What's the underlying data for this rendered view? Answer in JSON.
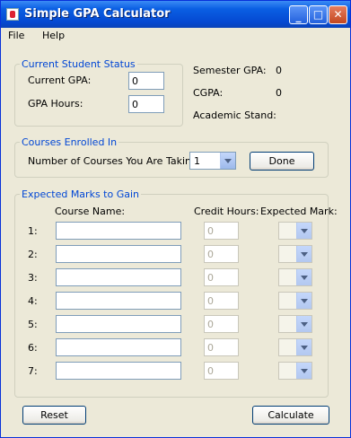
{
  "window": {
    "title": "Simple GPA Calculator"
  },
  "menu": {
    "items": [
      "File",
      "Help"
    ]
  },
  "status": {
    "title": "Current Student Status",
    "current_gpa_label": "Current GPA:",
    "current_gpa_value": "0",
    "gpa_hours_label": "GPA Hours:",
    "gpa_hours_value": "0",
    "semester_gpa_label": "Semester GPA:",
    "semester_gpa_value": "0",
    "cgpa_label": "CGPA:",
    "cgpa_value": "0",
    "academic_stand_label": "Academic Stand:",
    "academic_stand_value": ""
  },
  "courses": {
    "title": "Courses Enrolled In",
    "count_label": "Number of Courses You Are Taking",
    "count_value": "1",
    "done_label": "Done"
  },
  "marks": {
    "title": "Expected Marks to Gain",
    "course_name_header": "Course Name:",
    "credit_hours_header": "Credit Hours:",
    "expected_mark_header": "Expected Mark:",
    "rows": [
      {
        "num": "1:",
        "name": "",
        "credit": "0",
        "mark": ""
      },
      {
        "num": "2:",
        "name": "",
        "credit": "0",
        "mark": ""
      },
      {
        "num": "3:",
        "name": "",
        "credit": "0",
        "mark": ""
      },
      {
        "num": "4:",
        "name": "",
        "credit": "0",
        "mark": ""
      },
      {
        "num": "5:",
        "name": "",
        "credit": "0",
        "mark": ""
      },
      {
        "num": "6:",
        "name": "",
        "credit": "0",
        "mark": ""
      },
      {
        "num": "7:",
        "name": "",
        "credit": "0",
        "mark": ""
      }
    ]
  },
  "actions": {
    "reset_label": "Reset",
    "calculate_label": "Calculate"
  },
  "colors": {
    "titlebar": "#0A5FE3",
    "panel_title": "#0046D5",
    "window_bg": "#ECE9D8"
  },
  "icons": {
    "app": "java-cup-icon",
    "minimize": "minimize-icon",
    "maximize": "maximize-icon",
    "close": "close-icon"
  }
}
